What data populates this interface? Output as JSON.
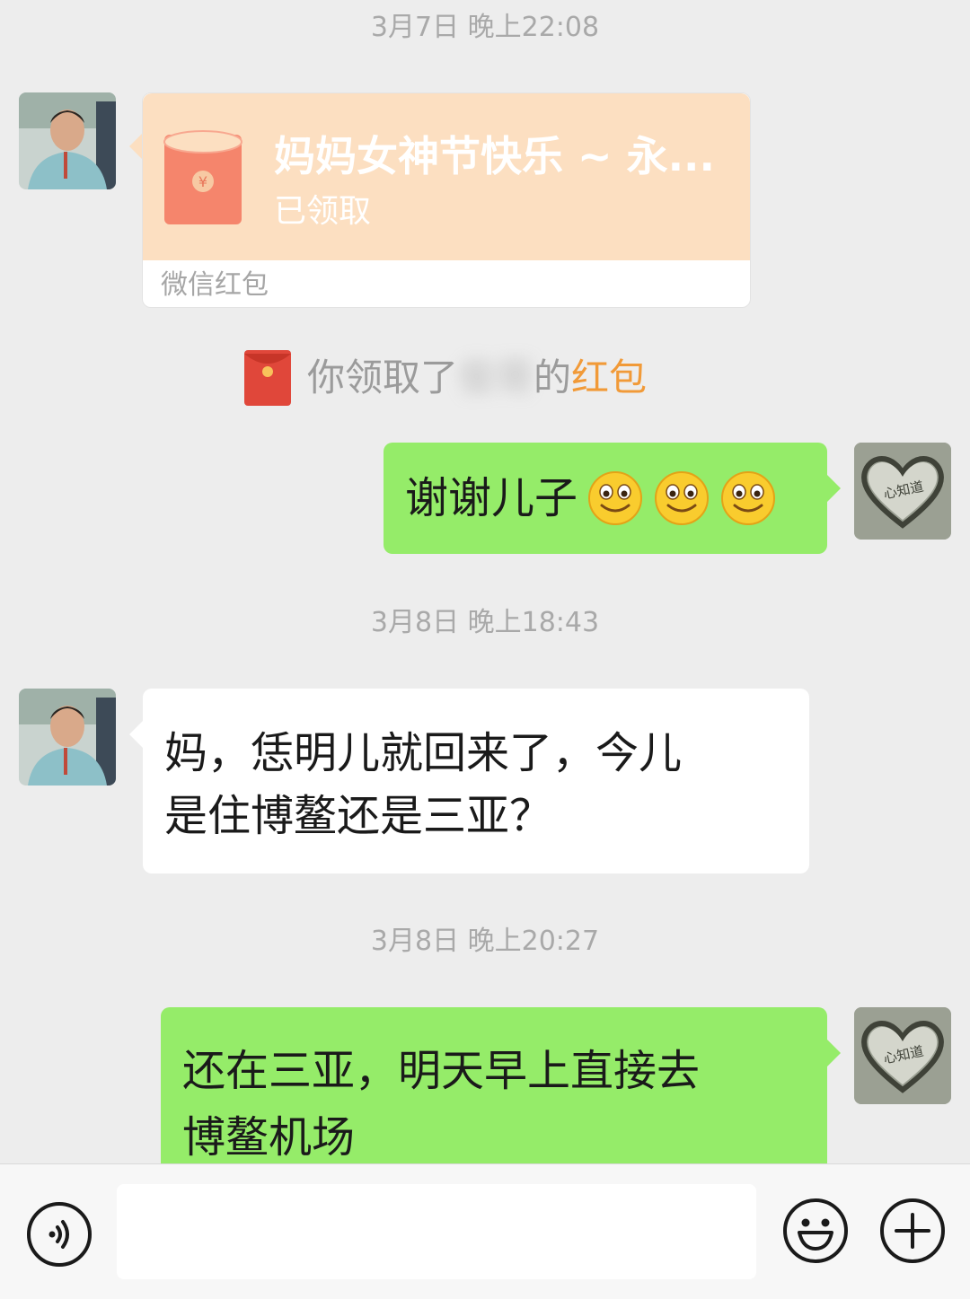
{
  "messages": {
    "ts1": "3月7日 晚上22:08",
    "red_packet": {
      "title": "妈妈女神节快乐 ~ 永...",
      "status": "已领取",
      "footer": "微信红包"
    },
    "system_notice": {
      "prefix": "你领取了",
      "name_blurred": "俊哥",
      "suffix": "的",
      "link": "红包"
    },
    "msg1": {
      "text": "谢谢儿子",
      "emoji_count": 3
    },
    "ts2": "3月8日 晚上18:43",
    "msg2": {
      "line1": "妈，恁明儿就回来了，今儿",
      "line2": "是住博鳌还是三亚？"
    },
    "ts3": "3月8日 晚上20:27",
    "msg3": {
      "line1": "还在三亚，明天早上直接去",
      "line2": "博鳌机场"
    }
  },
  "colors": {
    "background": "#ededed",
    "bubble_self": "#95ec69",
    "bubble_other": "#ffffff",
    "red_packet": "#fcdfc1",
    "link": "#f19a38"
  },
  "input_bar": {
    "voice_icon": "voice-icon",
    "emoji_icon": "emoji-icon",
    "plus_icon": "plus-icon",
    "value": ""
  }
}
